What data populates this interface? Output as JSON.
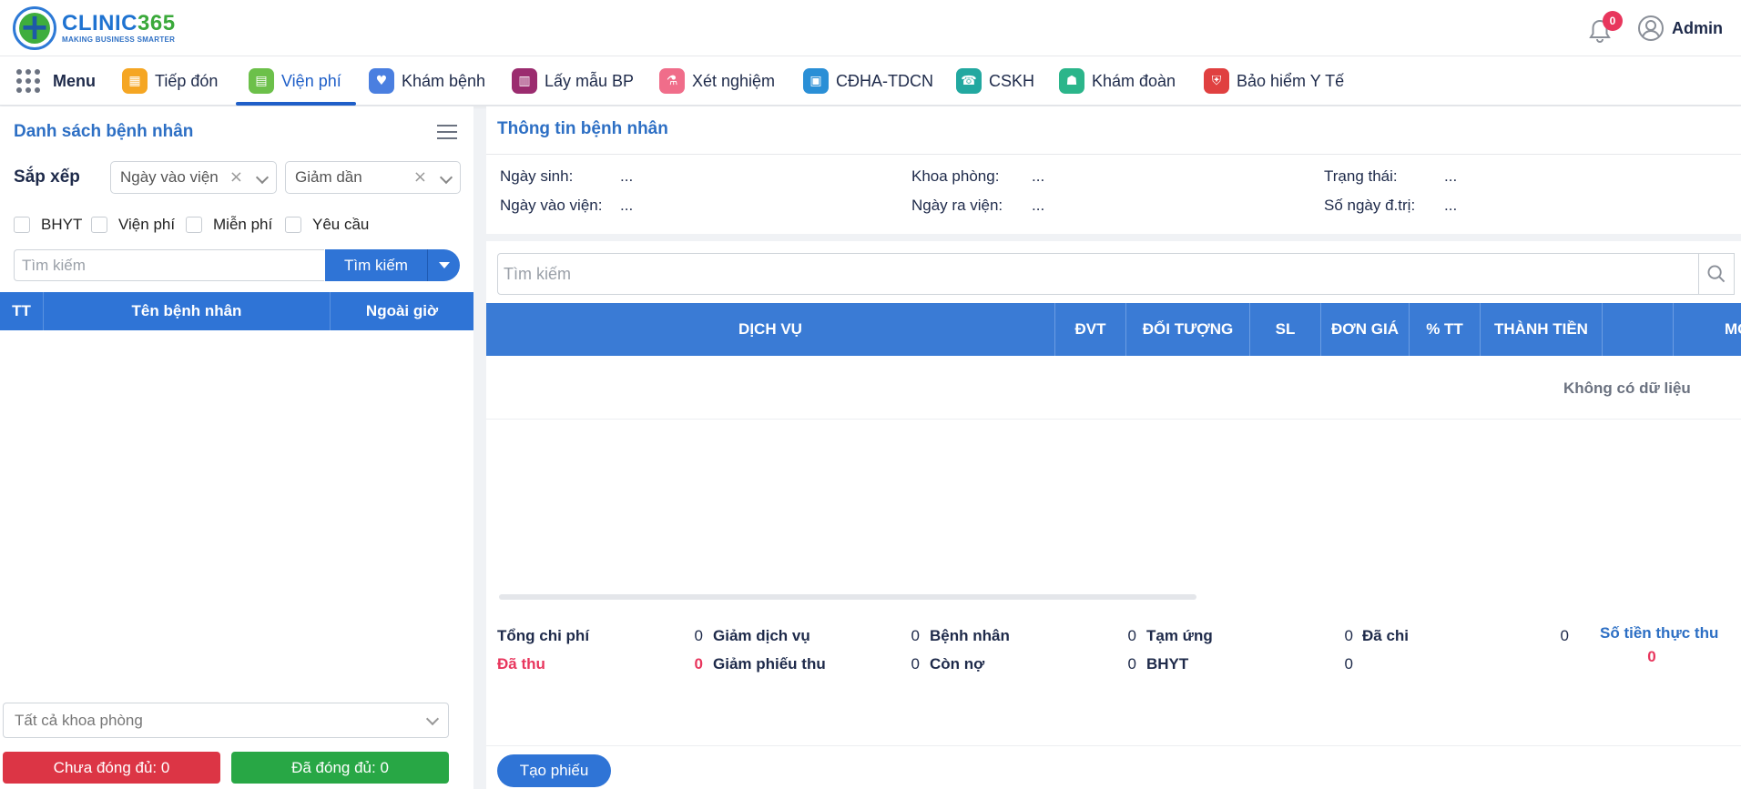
{
  "header": {
    "logo_name": "CLINIC",
    "logo_num": "365",
    "logo_tagline": "MAKING BUSINESS SMARTER",
    "notification_count": "0",
    "user_name": "Admin"
  },
  "nav": {
    "menu_label": "Menu",
    "items": [
      {
        "label": "Tiếp đón",
        "color": "#f5a623"
      },
      {
        "label": "Viện phí",
        "color": "#6cc04a"
      },
      {
        "label": "Khám bệnh",
        "color": "#4a7fe0"
      },
      {
        "label": "Lấy mẫu BP",
        "color": "#9b2c6f"
      },
      {
        "label": "Xét nghiệm",
        "color": "#f06d8a"
      },
      {
        "label": "CĐHA-TDCN",
        "color": "#2a8fd6"
      },
      {
        "label": "CSKH",
        "color": "#22a8a0"
      },
      {
        "label": "Khám đoàn",
        "color": "#2bb58a"
      },
      {
        "label": "Bảo hiểm Y Tế",
        "color": "#e04040"
      }
    ]
  },
  "left": {
    "title": "Danh sách bệnh nhân",
    "sort_label": "Sắp xếp",
    "sort_field": "Ngày vào viện",
    "sort_order": "Giảm dần",
    "filters": [
      "BHYT",
      "Viện phí",
      "Miễn phí",
      "Yêu cầu"
    ],
    "search_placeholder": "Tìm kiếm",
    "search_button": "Tìm kiếm",
    "columns": [
      "TT",
      "Tên bệnh nhân",
      "Ngoài giờ"
    ],
    "dept_placeholder": "Tất cả khoa phòng",
    "unpaid_button": "Chưa đóng đủ: 0",
    "paid_button": "Đã đóng đủ: 0"
  },
  "info": {
    "title": "Thông tin bệnh nhân",
    "fields": {
      "dob_label": "Ngày sinh:",
      "dob_value": "...",
      "dept_label": "Khoa phòng:",
      "dept_value": "...",
      "status_label": "Trạng thái:",
      "status_value": "...",
      "admit_label": "Ngày vào viện:",
      "admit_value": "...",
      "discharge_label": "Ngày ra viện:",
      "discharge_value": "...",
      "days_label": "Số ngày đ.trị:",
      "days_value": "..."
    }
  },
  "main": {
    "search_placeholder": "Tìm kiếm",
    "columns": [
      "DỊCH VỤ",
      "ĐVT",
      "ĐỐI TƯỢNG",
      "SL",
      "ĐƠN GIÁ",
      "% TT",
      "THÀNH TIỀN",
      "",
      "MG"
    ],
    "empty_text": "Không có dữ liệu",
    "summary": {
      "total_cost_label": "Tổng chi phí",
      "total_cost": "0",
      "service_discount_label": "Giảm dịch vụ",
      "service_discount": "0",
      "patient_label": "Bệnh nhân",
      "patient": "0",
      "advance_label": "Tạm ứng",
      "advance": "0",
      "spent_label": "Đã chi",
      "spent": "0",
      "collected_label": "Đã thu",
      "collected": "0",
      "receipt_discount_label": "Giảm phiếu thu",
      "receipt_discount": "0",
      "debt_label": "Còn nợ",
      "debt": "0",
      "bhyt_label": "BHYT",
      "bhyt": "0",
      "actual_label": "Số tiền thực thu",
      "actual": "0"
    },
    "create_button": "Tạo phiếu"
  }
}
